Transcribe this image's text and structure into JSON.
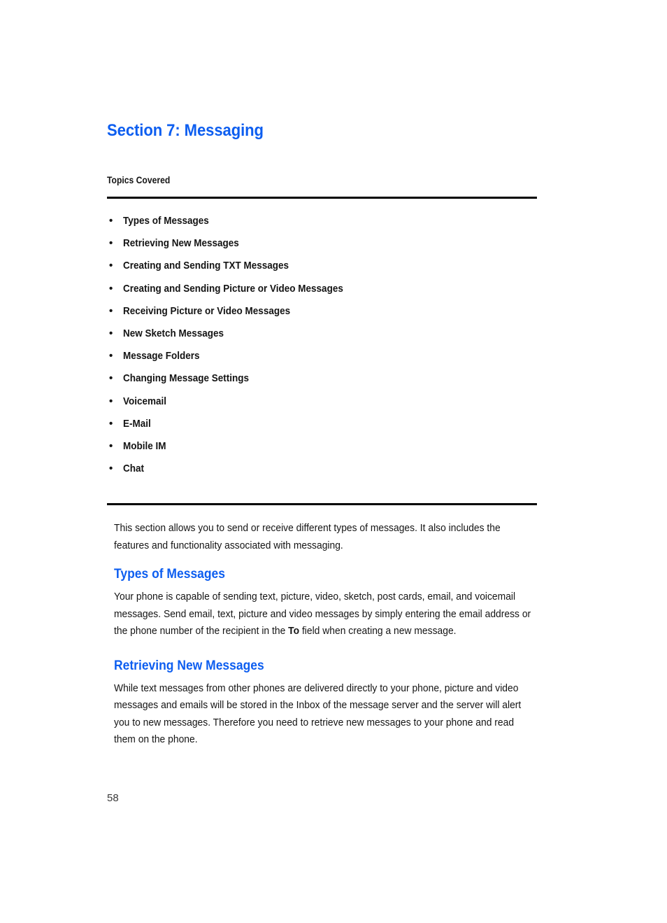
{
  "document": {
    "section_title": "Section 7: Messaging",
    "topics_label": "Topics Covered",
    "page_number": "58"
  },
  "topics": [
    {
      "label": "Types of Messages"
    },
    {
      "label": "Retrieving New Messages"
    },
    {
      "label": "Creating and Sending TXT Messages"
    },
    {
      "label": "Creating and Sending Picture or Video Messages"
    },
    {
      "label": "Receiving Picture or Video Messages"
    },
    {
      "label": "New Sketch Messages"
    },
    {
      "label": "Message Folders"
    },
    {
      "label": "Changing Message Settings"
    },
    {
      "label": "Voicemail"
    },
    {
      "label": "E-Mail"
    },
    {
      "label": "Mobile IM"
    },
    {
      "label": "Chat"
    }
  ],
  "bullet_glyph": "•",
  "intro": {
    "paragraph": "This section allows you to send or receive different types of messages. It also includes the features and functionality associated with messaging."
  },
  "sections": [
    {
      "heading": "Types of Messages",
      "paragraph_part1": "Your phone is capable of sending text, picture, video, sketch, post cards, email, and voicemail messages. Send email, text, picture and video messages by simply entering the email address or the phone number of the recipient in the ",
      "paragraph_bold": "To",
      "paragraph_part2": " field when creating a new message."
    },
    {
      "heading": "Retrieving New Messages",
      "paragraph": "While text messages from other phones are delivered directly to your phone, picture and video messages and emails will be stored in the Inbox of the message server and the server will alert you to new messages. Therefore you need to retrieve new messages to your phone and read them on the phone."
    }
  ],
  "colors": {
    "heading_blue": "#0d5ef0",
    "body_black": "#141414",
    "rule_black": "#000000",
    "page_background": "#ffffff"
  }
}
